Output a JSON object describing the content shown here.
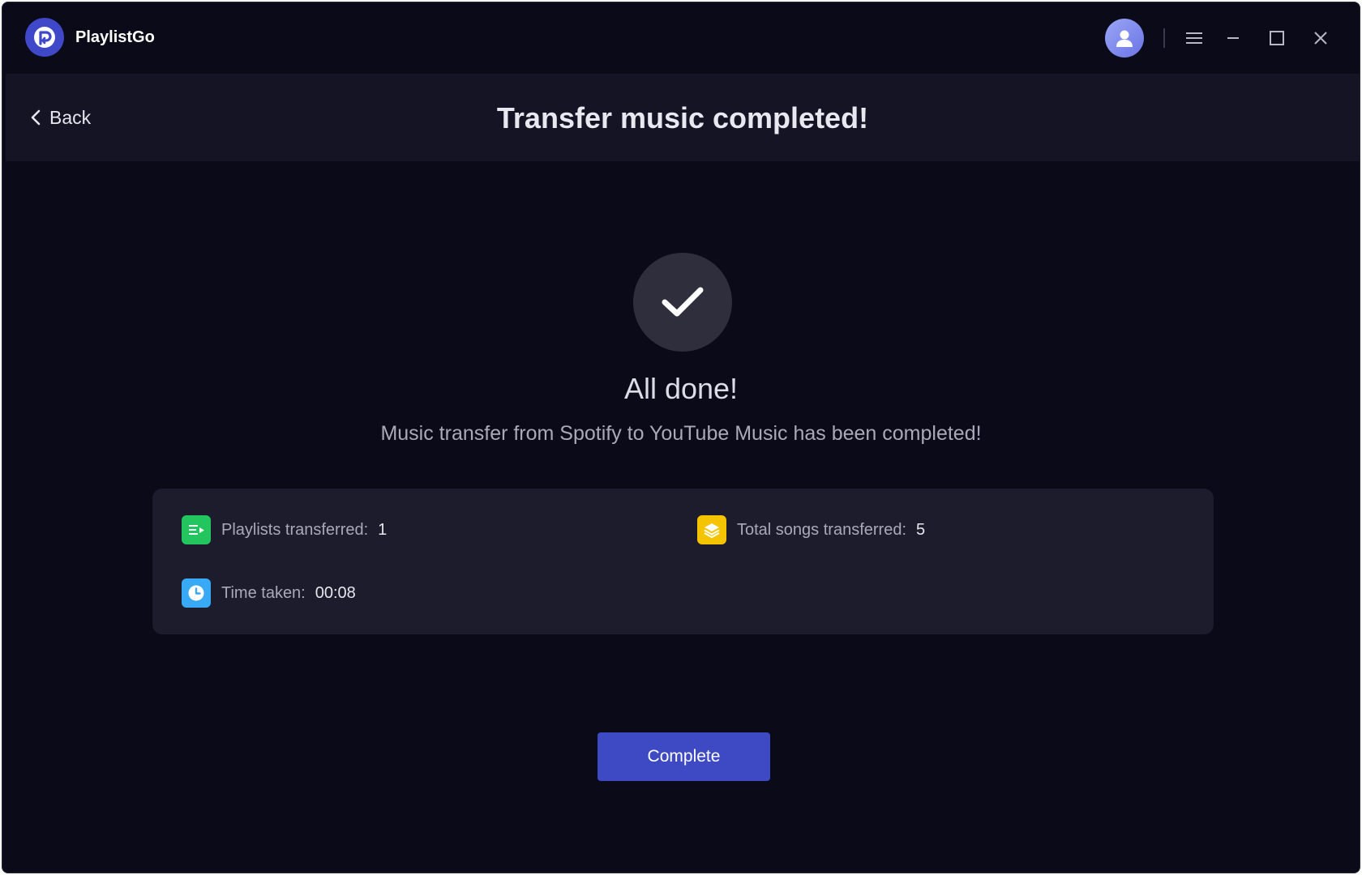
{
  "app": {
    "name": "PlaylistGo",
    "accent": "#3d4ac4"
  },
  "titlebar": {
    "icons": [
      "user-avatar-icon",
      "menu-icon",
      "minimize-icon",
      "maximize-icon",
      "close-icon"
    ]
  },
  "header": {
    "back_label": "Back",
    "title": "Transfer music completed!"
  },
  "result": {
    "heading": "All done!",
    "message": "Music transfer from Spotify to YouTube Music has been completed!"
  },
  "stats": {
    "playlists_label": "Playlists transferred:",
    "playlists_value": "1",
    "songs_label": "Total songs transferred:",
    "songs_value": "5",
    "time_label": "Time taken:",
    "time_value": "00:08",
    "colors": {
      "playlists_icon": "#22c55e",
      "songs_icon": "#f5c400",
      "time_icon": "#38a9f5"
    }
  },
  "actions": {
    "complete_label": "Complete"
  }
}
